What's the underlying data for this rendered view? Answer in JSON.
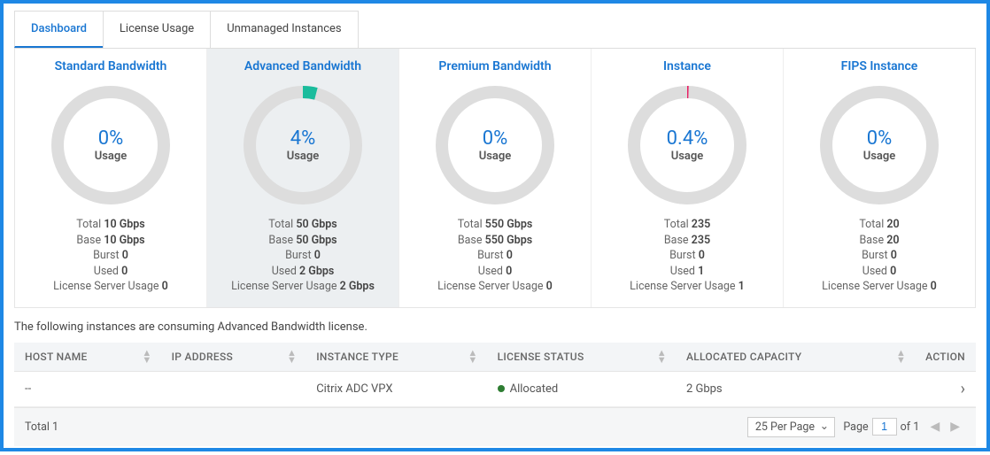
{
  "tabs": {
    "dashboard": "Dashboard",
    "license_usage": "License Usage",
    "unmanaged": "Unmanaged Instances"
  },
  "chart_data": [
    {
      "type": "pie",
      "title": "Standard Bandwidth",
      "values": [
        0,
        100
      ],
      "pct_label": "0%",
      "usage_label": "Usage",
      "accent": "#ddd",
      "total_l": "Total",
      "total_v": "10 Gbps",
      "base_l": "Base",
      "base_v": "10 Gbps",
      "burst_l": "Burst",
      "burst_v": "0",
      "used_l": "Used",
      "used_v": "0",
      "lsu_l": "License Server Usage",
      "lsu_v": "0"
    },
    {
      "type": "pie",
      "title": "Advanced Bandwidth",
      "values": [
        4,
        96
      ],
      "pct_label": "4%",
      "usage_label": "Usage",
      "accent": "#1abc9c",
      "total_l": "Total",
      "total_v": "50 Gbps",
      "base_l": "Base",
      "base_v": "50 Gbps",
      "burst_l": "Burst",
      "burst_v": "0",
      "used_l": "Used",
      "used_v": "2 Gbps",
      "lsu_l": "License Server Usage",
      "lsu_v": "2 Gbps"
    },
    {
      "type": "pie",
      "title": "Premium Bandwidth",
      "values": [
        0,
        100
      ],
      "pct_label": "0%",
      "usage_label": "Usage",
      "accent": "#ddd",
      "total_l": "Total",
      "total_v": "550 Gbps",
      "base_l": "Base",
      "base_v": "550 Gbps",
      "burst_l": "Burst",
      "burst_v": "0",
      "used_l": "Used",
      "used_v": "0",
      "lsu_l": "License Server Usage",
      "lsu_v": "0"
    },
    {
      "type": "pie",
      "title": "Instance",
      "values": [
        0.4,
        99.6
      ],
      "pct_label": "0.4%",
      "usage_label": "Usage",
      "accent": "#e91e63",
      "total_l": "Total",
      "total_v": "235",
      "base_l": "Base",
      "base_v": "235",
      "burst_l": "Burst",
      "burst_v": "0",
      "used_l": "Used",
      "used_v": "1",
      "lsu_l": "License Server Usage",
      "lsu_v": "1"
    },
    {
      "type": "pie",
      "title": "FIPS Instance",
      "values": [
        0,
        100
      ],
      "pct_label": "0%",
      "usage_label": "Usage",
      "accent": "#ddd",
      "total_l": "Total",
      "total_v": "20",
      "base_l": "Base",
      "base_v": "20",
      "burst_l": "Burst",
      "burst_v": "0",
      "used_l": "Used",
      "used_v": "0",
      "lsu_l": "License Server Usage",
      "lsu_v": "0"
    }
  ],
  "caption": "The following instances are consuming Advanced Bandwidth license.",
  "table": {
    "headers": {
      "host": "HOST NAME",
      "ip": "IP ADDRESS",
      "type": "INSTANCE TYPE",
      "status": "LICENSE STATUS",
      "cap": "ALLOCATED CAPACITY",
      "action": "ACTION"
    },
    "row": {
      "host": "--",
      "ip": "",
      "type": "Citrix ADC VPX",
      "status": "Allocated",
      "cap": "2 Gbps"
    }
  },
  "footer": {
    "total_label": "Total",
    "total_value": "1",
    "per_page": "25 Per Page",
    "page_label": "Page",
    "page_value": "1",
    "page_of": "of 1"
  }
}
